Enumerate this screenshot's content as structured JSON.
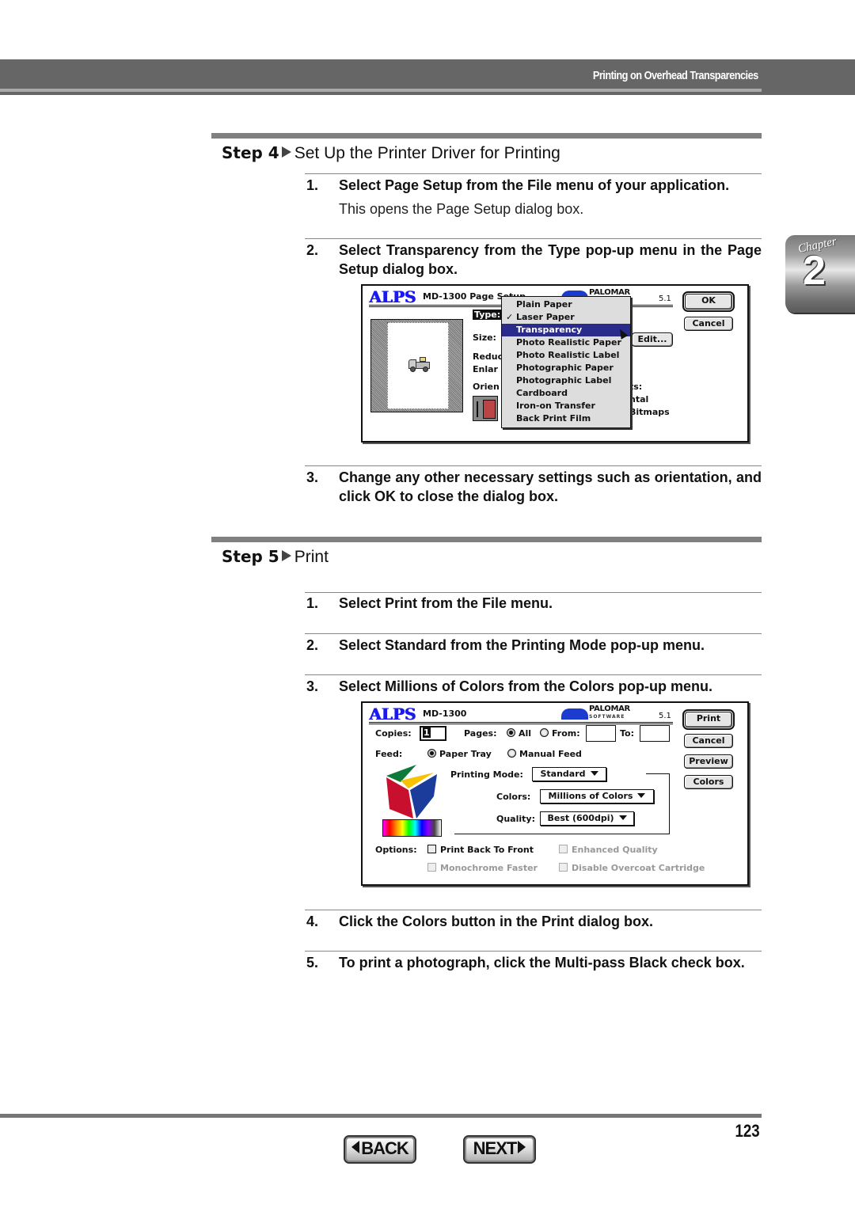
{
  "header": {
    "section_title": "Printing on Overhead Transparencies"
  },
  "chapter_tab": {
    "word": "Chapter",
    "number": "2"
  },
  "step4": {
    "label": "Step 4",
    "title": "Set Up the Printer Driver for Printing",
    "items": [
      {
        "num": "1.",
        "text": "Select Page Setup from the File menu of your application.",
        "sub": "This opens the Page Setup dialog box."
      },
      {
        "num": "2.",
        "text": "Select Transparency from the Type pop-up menu in the Page Setup dialog box."
      },
      {
        "num": "3.",
        "text": "Change any other necessary settings such as orientation, and click OK to close the dialog box."
      }
    ]
  },
  "page_setup_dialog": {
    "brand": "ALPS",
    "title": "MD-1300 Page Setup",
    "vendor": "PALOMAR",
    "version": "5.1",
    "ok_label": "OK",
    "cancel_label": "Cancel",
    "edit_label": "Edit...",
    "labels": {
      "type": "Type:",
      "size": "Size:",
      "reduce": "Reduc",
      "enlarge": "Enlar",
      "orient": "Orien",
      "effects": "ts:",
      "horizontal": "ntal",
      "bitmaps": "Bitmaps"
    },
    "type_menu": {
      "checked": "Laser Paper",
      "highlighted": "Transparency",
      "options": [
        "Plain Paper",
        "Laser Paper",
        "Transparency",
        "Photo Realistic Paper",
        "Photo Realistic Label",
        "Photographic Paper",
        "Photographic Label",
        "Cardboard",
        "Iron-on Transfer",
        "Back Print Film"
      ]
    }
  },
  "step5": {
    "label": "Step 5",
    "title": "Print",
    "items": [
      {
        "num": "1.",
        "text": "Select Print from the File menu."
      },
      {
        "num": "2.",
        "text": "Select Standard from the Printing Mode pop-up menu."
      },
      {
        "num": "3.",
        "text": "Select Millions of Colors from the Colors pop-up menu."
      },
      {
        "num": "4.",
        "text": "Click the Colors button in the Print dialog box."
      },
      {
        "num": "5.",
        "text": "To print a photograph, click the Multi-pass Black check box."
      }
    ]
  },
  "print_dialog": {
    "brand": "ALPS",
    "title": "MD-1300",
    "vendor": "PALOMAR",
    "vendor_sub": "SOFTWARE",
    "version": "5.1",
    "buttons": {
      "print": "Print",
      "cancel": "Cancel",
      "preview": "Preview",
      "colors": "Colors"
    },
    "copies_label": "Copies:",
    "copies_value": "1",
    "pages_label": "Pages:",
    "pages_all": "All",
    "pages_from": "From:",
    "pages_to": "To:",
    "from_value": "",
    "to_value": "",
    "feed_label": "Feed:",
    "feed_paper_tray": "Paper Tray",
    "feed_manual": "Manual Feed",
    "printing_mode_label": "Printing Mode:",
    "printing_mode_value": "Standard",
    "colors_label": "Colors:",
    "colors_value": "Millions of Colors",
    "quality_label": "Quality:",
    "quality_value": "Best (600dpi)",
    "options_label": "Options:",
    "options": [
      {
        "label": "Print Back To Front",
        "enabled": true,
        "checked": false
      },
      {
        "label": "Enhanced Quality",
        "enabled": false,
        "checked": false
      },
      {
        "label": "Monochrome Faster",
        "enabled": false,
        "checked": false
      },
      {
        "label": "Disable Overcoat Cartridge",
        "enabled": false,
        "checked": false
      }
    ]
  },
  "footer": {
    "page_number": "123",
    "back_label": "BACK",
    "next_label": "NEXT"
  }
}
